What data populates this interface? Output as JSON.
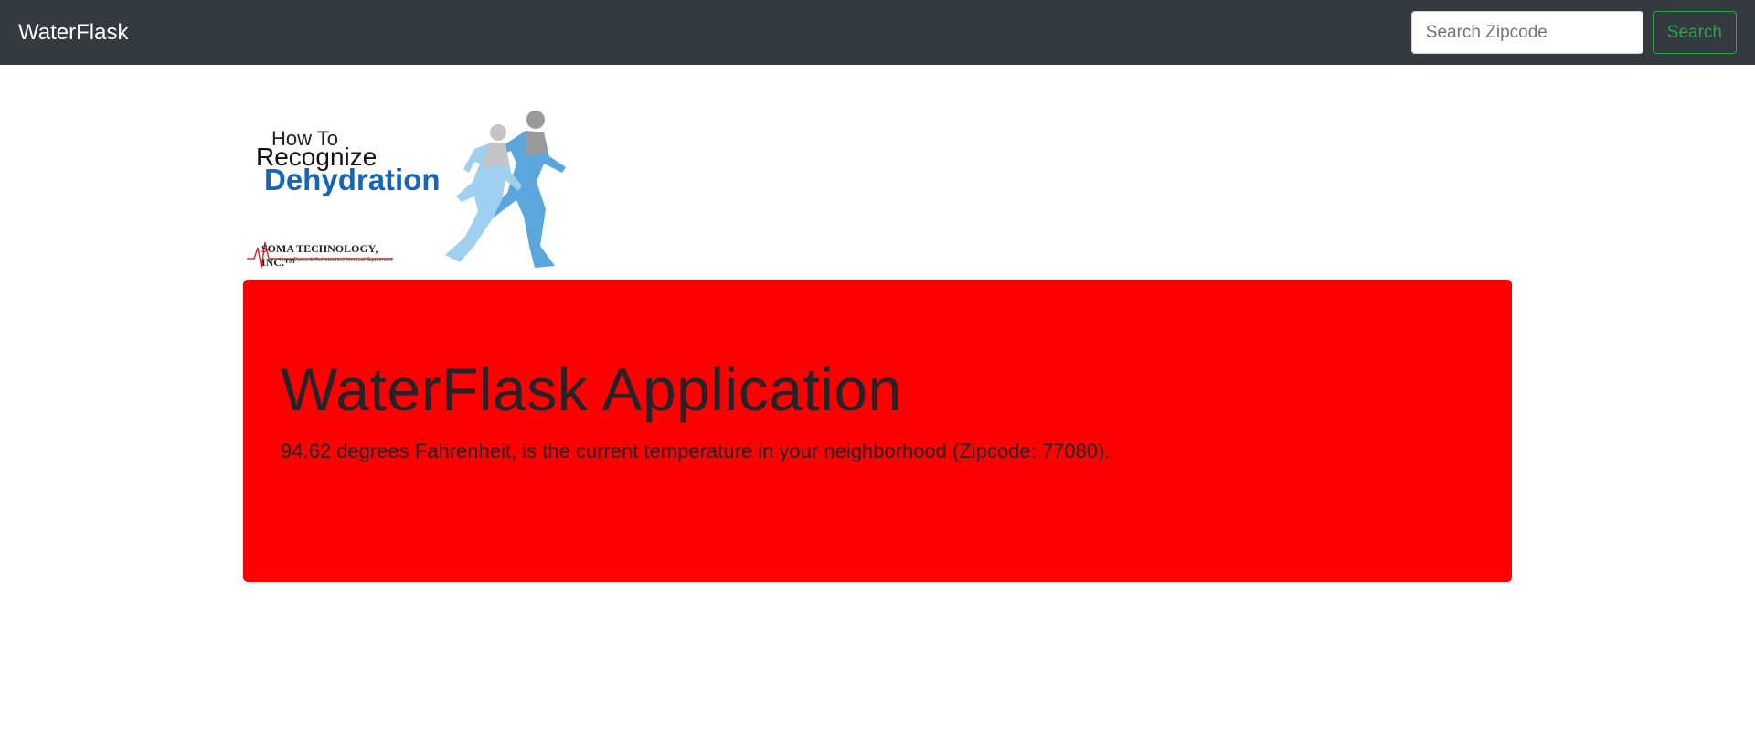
{
  "navbar": {
    "brand": "WaterFlask",
    "search_placeholder": "Search Zipcode",
    "search_button": "Search"
  },
  "logo": {
    "line1": "How To",
    "line2": "Recognize",
    "line3": "Dehydration",
    "company": "SOMA TECHNOLOGY, INC.™",
    "company_tagline": "New, Demo & Refurbished Medical Equipment"
  },
  "jumbotron": {
    "title": "WaterFlask Application",
    "lead": "94.62 degrees Fahrenheit, is the current temperature in your neighborhood (Zipcode: 77080)."
  },
  "colors": {
    "navbar_bg": "#343a40",
    "jumbotron_bg": "#ff0000",
    "search_button": "#28a745",
    "logo_blue": "#1565b8"
  }
}
